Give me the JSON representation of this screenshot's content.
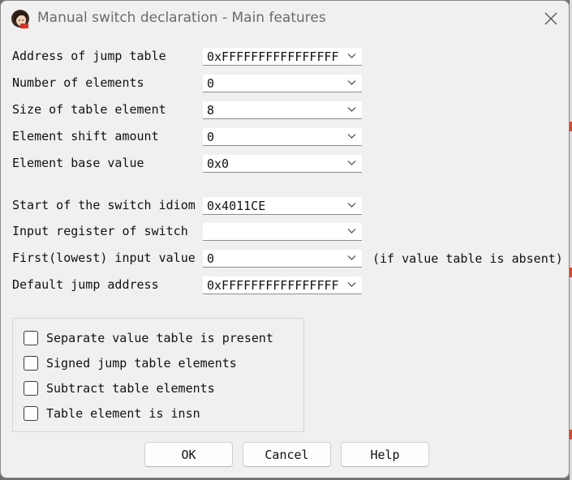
{
  "window": {
    "title": "Manual switch declaration - Main features",
    "icon": "app-avatar-icon"
  },
  "fields": [
    {
      "label": "Address of jump table",
      "value": "0xFFFFFFFFFFFFFFFF"
    },
    {
      "label": "Number of elements",
      "value": "0"
    },
    {
      "label": "Size of table element",
      "value": "8"
    },
    {
      "label": "Element shift amount",
      "value": "0"
    },
    {
      "label": "Element base value",
      "value": "0x0"
    },
    {
      "label": "Start of the switch idiom",
      "value": "0x4011CE"
    },
    {
      "label": "Input register of switch",
      "value": ""
    },
    {
      "label": "First(lowest) input value",
      "value": "0"
    },
    {
      "label": "Default jump address",
      "value": "0xFFFFFFFFFFFFFFFF"
    }
  ],
  "first_input_note": "(if value table is absent)",
  "checkboxes": [
    {
      "label": "Separate value table is present",
      "checked": false
    },
    {
      "label": "Signed jump table elements",
      "checked": false
    },
    {
      "label": "Subtract table elements",
      "checked": false
    },
    {
      "label": "Table element is insn",
      "checked": false
    }
  ],
  "buttons": {
    "ok": "OK",
    "cancel": "Cancel",
    "help": "Help"
  },
  "colors": {
    "dialog_bg": "#f0f0f0",
    "title_text": "#6b6b6b",
    "field_bg": "#ffffff"
  }
}
